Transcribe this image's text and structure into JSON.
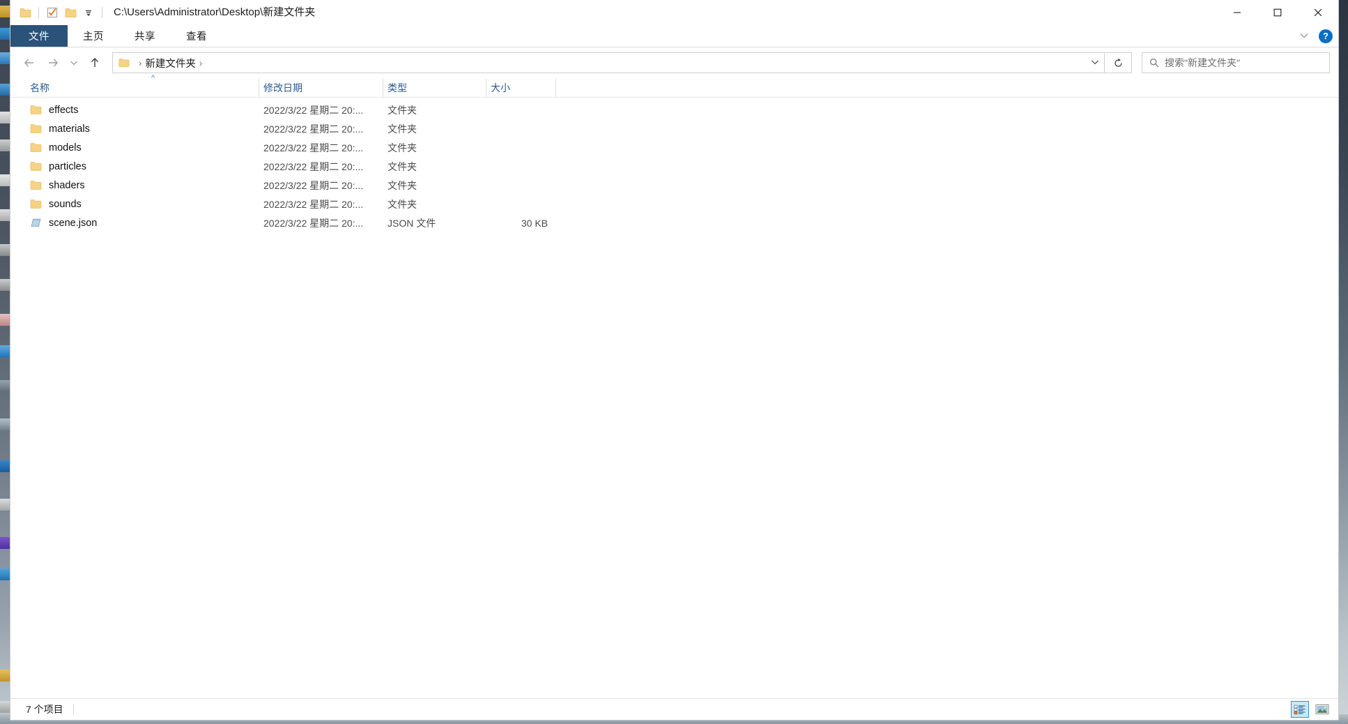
{
  "window": {
    "title_path": "C:\\Users\\Administrator\\Desktop\\新建文件夹",
    "quick_access": [
      {
        "name": "folder-icon",
        "label": "文件夹"
      },
      {
        "name": "properties-icon",
        "label": "属性"
      },
      {
        "name": "new-folder-icon",
        "label": "新建文件夹"
      },
      {
        "name": "customize-qat-chevron-icon",
        "label": "自定义快速访问工具栏"
      }
    ],
    "controls": {
      "minimize": "—",
      "maximize": "□",
      "close": "✕"
    }
  },
  "ribbon": {
    "tabs": [
      {
        "label": "文件",
        "active": true
      },
      {
        "label": "主页",
        "active": false
      },
      {
        "label": "共享",
        "active": false
      },
      {
        "label": "查看",
        "active": false
      }
    ],
    "collapse_chevron": "⌄",
    "help_label": "?"
  },
  "nav": {
    "back": "←",
    "forward": "→",
    "recent": "⌄",
    "up": "↑",
    "breadcrumb": {
      "folder_icon": "folder-icon",
      "sep1": "›",
      "current": "新建文件夹",
      "sep2": "›"
    },
    "address_chevron": "⌄",
    "refresh": "↻"
  },
  "search": {
    "placeholder": "搜索\"新建文件夹\"",
    "value": ""
  },
  "columns": {
    "name": "名称",
    "date": "修改日期",
    "type": "类型",
    "size": "大小",
    "sort_caret": "^"
  },
  "files": [
    {
      "name": "effects",
      "icon": "folder-icon",
      "date": "2022/3/22 星期二 20:...",
      "type": "文件夹",
      "size": ""
    },
    {
      "name": "materials",
      "icon": "folder-icon",
      "date": "2022/3/22 星期二 20:...",
      "type": "文件夹",
      "size": ""
    },
    {
      "name": "models",
      "icon": "folder-icon",
      "date": "2022/3/22 星期二 20:...",
      "type": "文件夹",
      "size": ""
    },
    {
      "name": "particles",
      "icon": "folder-icon",
      "date": "2022/3/22 星期二 20:...",
      "type": "文件夹",
      "size": ""
    },
    {
      "name": "shaders",
      "icon": "folder-icon",
      "date": "2022/3/22 星期二 20:...",
      "type": "文件夹",
      "size": ""
    },
    {
      "name": "sounds",
      "icon": "folder-icon",
      "date": "2022/3/22 星期二 20:...",
      "type": "文件夹",
      "size": ""
    },
    {
      "name": "scene.json",
      "icon": "json-file-icon",
      "date": "2022/3/22 星期二 20:...",
      "type": "JSON 文件",
      "size": "30 KB"
    }
  ],
  "status": {
    "item_count": "7 个项目",
    "views": [
      {
        "name": "details-view-button",
        "active": true
      },
      {
        "name": "large-icons-view-button",
        "active": false
      }
    ]
  },
  "colors": {
    "file_tab": "#2b5278",
    "header_text": "#2b5a8e",
    "folder": "#f7d27f",
    "help_blue": "#0b6ec4",
    "view_active": "#cbe8f7"
  }
}
